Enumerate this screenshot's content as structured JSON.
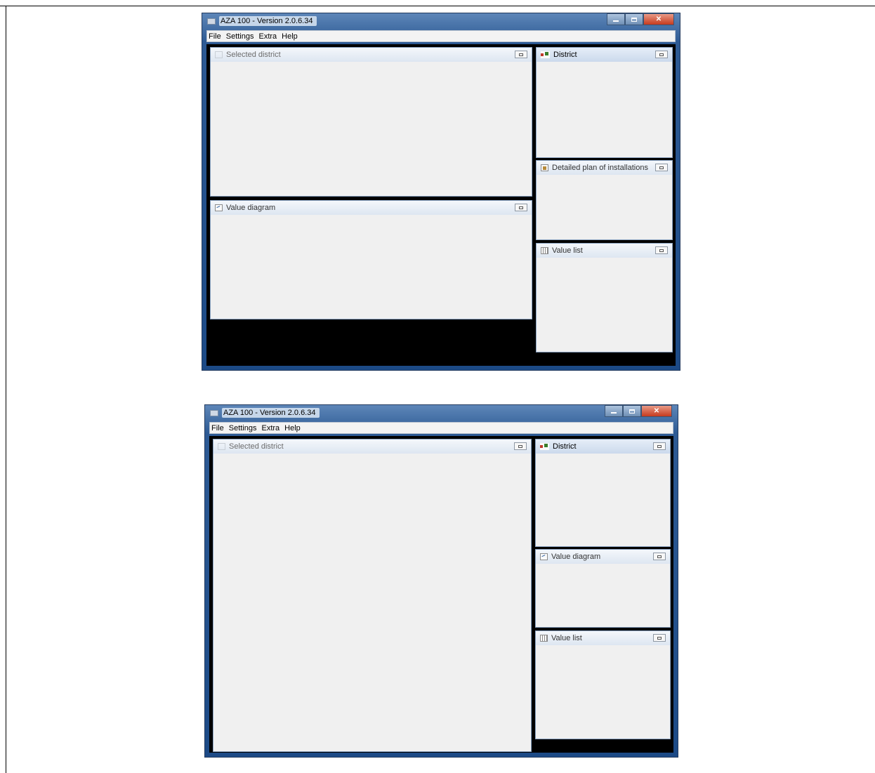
{
  "windows": [
    {
      "title": "AZA 100 - Version 2.0.6.34",
      "menu": [
        "File",
        "Settings",
        "Extra",
        "Help"
      ],
      "panels": {
        "selected_district": "Selected district",
        "district": "District",
        "detailed_plan": "Detailed plan of installations",
        "value_diagram": "Value diagram",
        "value_list": "Value list"
      }
    },
    {
      "title": "AZA 100 - Version 2.0.6.34",
      "menu": [
        "File",
        "Settings",
        "Extra",
        "Help"
      ],
      "panels": {
        "selected_district": "Selected district",
        "district": "District",
        "value_diagram": "Value diagram",
        "value_list": "Value list"
      }
    }
  ],
  "icons": {
    "title": "app-window-icon",
    "minimize": "minimize-icon",
    "maximize": "maximize-icon",
    "close": "close-icon",
    "district": "district-map-icon",
    "diagram": "chart-icon",
    "list": "table-icon",
    "plan": "plan-icon",
    "panel_button": "panel-options-icon"
  },
  "colors": {
    "window_frame": "#1c4a86",
    "panel_background": "#f0f0f0",
    "workspace": "#000000",
    "close_button": "#c63a1e"
  }
}
